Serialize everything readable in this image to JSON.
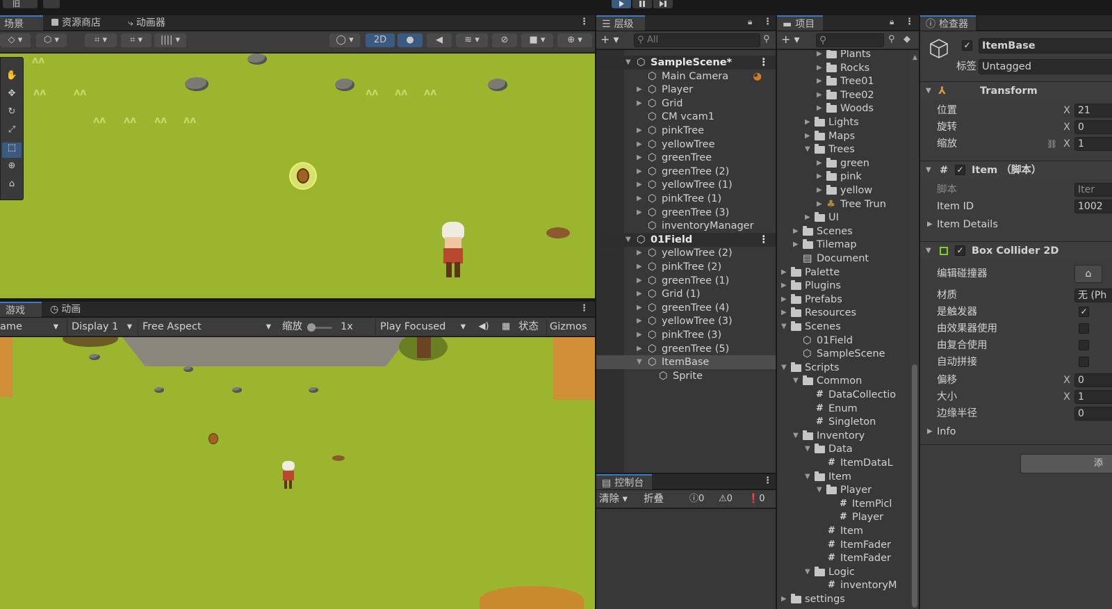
{
  "topbar": {
    "left_label": "旧",
    "play_icon": "play-icon",
    "pause_icon": "pause-icon",
    "step_icon": "step-icon"
  },
  "scene_panel": {
    "tabs": [
      {
        "label": "场景",
        "icon": "scene-icon"
      },
      {
        "label": "资源商店",
        "icon": "store-icon"
      },
      {
        "label": "动画器",
        "icon": "animator-icon"
      }
    ],
    "toolbar": {
      "mode_2d": "2D"
    }
  },
  "game_panel": {
    "tabs": [
      {
        "label": "游戏",
        "icon": "game-icon"
      },
      {
        "label": "动画",
        "icon": "animation-icon"
      }
    ],
    "toolbar": {
      "view": "ame",
      "display": "Display 1",
      "aspect": "Free Aspect",
      "scale_label": "缩放",
      "scale_value": "1x",
      "play_mode": "Play Focused",
      "stats": "状态",
      "gizmos": "Gizmos"
    }
  },
  "hierarchy": {
    "tab": "层级",
    "search_placeholder": "All",
    "items": [
      {
        "label": "SampleScene*",
        "type": "scene"
      },
      {
        "label": "Main Camera",
        "type": "object"
      },
      {
        "label": "Player",
        "type": "object"
      },
      {
        "label": "Grid",
        "type": "object"
      },
      {
        "label": "CM vcam1",
        "type": "object"
      },
      {
        "label": "pinkTree",
        "type": "object"
      },
      {
        "label": "yellowTree",
        "type": "object"
      },
      {
        "label": "greenTree",
        "type": "object"
      },
      {
        "label": "greenTree (2)",
        "type": "object"
      },
      {
        "label": "yellowTree (1)",
        "type": "object"
      },
      {
        "label": "pinkTree (1)",
        "type": "object"
      },
      {
        "label": "greenTree (3)",
        "type": "object"
      },
      {
        "label": "inventoryManager",
        "type": "object"
      },
      {
        "label": "01Field",
        "type": "scene"
      },
      {
        "label": "yellowTree (2)",
        "type": "object"
      },
      {
        "label": "pinkTree (2)",
        "type": "object"
      },
      {
        "label": "greenTree (1)",
        "type": "object"
      },
      {
        "label": "Grid (1)",
        "type": "object"
      },
      {
        "label": "greenTree (4)",
        "type": "object"
      },
      {
        "label": "yellowTree (3)",
        "type": "object"
      },
      {
        "label": "pinkTree (3)",
        "type": "object"
      },
      {
        "label": "greenTree (5)",
        "type": "object"
      },
      {
        "label": "ItemBase",
        "type": "object"
      },
      {
        "label": "Sprite",
        "type": "object"
      }
    ]
  },
  "console": {
    "tab": "控制台",
    "clear": "清除",
    "collapse": "折叠",
    "errors": "0",
    "warnings": "0",
    "messages": "0"
  },
  "project": {
    "tab": "项目",
    "items": [
      {
        "label": "Plants",
        "kind": "folder"
      },
      {
        "label": "Rocks",
        "kind": "folder"
      },
      {
        "label": "Tree01",
        "kind": "folder"
      },
      {
        "label": "Tree02",
        "kind": "folder"
      },
      {
        "label": "Woods",
        "kind": "folder"
      },
      {
        "label": "Lights",
        "kind": "folder"
      },
      {
        "label": "Maps",
        "kind": "folder"
      },
      {
        "label": "Trees",
        "kind": "folder"
      },
      {
        "label": "green",
        "kind": "folder"
      },
      {
        "label": "pink",
        "kind": "folder"
      },
      {
        "label": "yellow",
        "kind": "folder"
      },
      {
        "label": "Tree Trun",
        "kind": "asset"
      },
      {
        "label": "UI",
        "kind": "folder"
      },
      {
        "label": "Scenes",
        "kind": "folder"
      },
      {
        "label": "Tilemap",
        "kind": "folder"
      },
      {
        "label": "Document",
        "kind": "doc"
      },
      {
        "label": "Palette",
        "kind": "folder"
      },
      {
        "label": "Plugins",
        "kind": "folder"
      },
      {
        "label": "Prefabs",
        "kind": "folder"
      },
      {
        "label": "Resources",
        "kind": "folder"
      },
      {
        "label": "Scenes",
        "kind": "folder"
      },
      {
        "label": "01Field",
        "kind": "scene"
      },
      {
        "label": "SampleScene",
        "kind": "scene"
      },
      {
        "label": "Scripts",
        "kind": "folder"
      },
      {
        "label": "Common",
        "kind": "folder"
      },
      {
        "label": "DataCollectio",
        "kind": "script"
      },
      {
        "label": "Enum",
        "kind": "script"
      },
      {
        "label": "Singleton",
        "kind": "script"
      },
      {
        "label": "Inventory",
        "kind": "folder"
      },
      {
        "label": "Data",
        "kind": "folder"
      },
      {
        "label": "ItemDataL",
        "kind": "script"
      },
      {
        "label": "Item",
        "kind": "folder"
      },
      {
        "label": "Player",
        "kind": "folder"
      },
      {
        "label": "ItemPicl",
        "kind": "script"
      },
      {
        "label": "Player",
        "kind": "script"
      },
      {
        "label": "Item",
        "kind": "script"
      },
      {
        "label": "ItemFader",
        "kind": "script"
      },
      {
        "label": "ItemFader",
        "kind": "script"
      },
      {
        "label": "Logic",
        "kind": "folder"
      },
      {
        "label": "inventoryM",
        "kind": "script"
      },
      {
        "label": "settings",
        "kind": "folder"
      }
    ]
  },
  "inspector": {
    "tab": "检查器",
    "object_name": "ItemBase",
    "tag_label": "标签",
    "tag_value": "Untagged",
    "transform": {
      "title": "Transform",
      "position_label": "位置",
      "position_x": "21",
      "rotation_label": "旋转",
      "rotation_x": "0",
      "scale_label": "缩放",
      "scale_x": "1",
      "x": "X"
    },
    "item_script": {
      "title": "Item （脚本）",
      "script_label": "脚本",
      "script_value": "Iter",
      "item_id_label": "Item ID",
      "item_id_value": "1002",
      "item_details_label": "Item Details"
    },
    "box_collider": {
      "title": "Box Collider 2D",
      "edit_label": "编辑碰撞器",
      "material_label": "材质",
      "material_value": "无 (Ph",
      "is_trigger_label": "是触发器",
      "used_by_effector_label": "由效果器使用",
      "used_by_composite_label": "由复合使用",
      "auto_tiling_label": "自动拼接",
      "offset_label": "偏移",
      "offset_x": "0",
      "size_label": "大小",
      "size_x": "1",
      "edge_radius_label": "边缘半径",
      "edge_radius_value": "0",
      "info_label": "Info"
    },
    "add_component": "添"
  }
}
